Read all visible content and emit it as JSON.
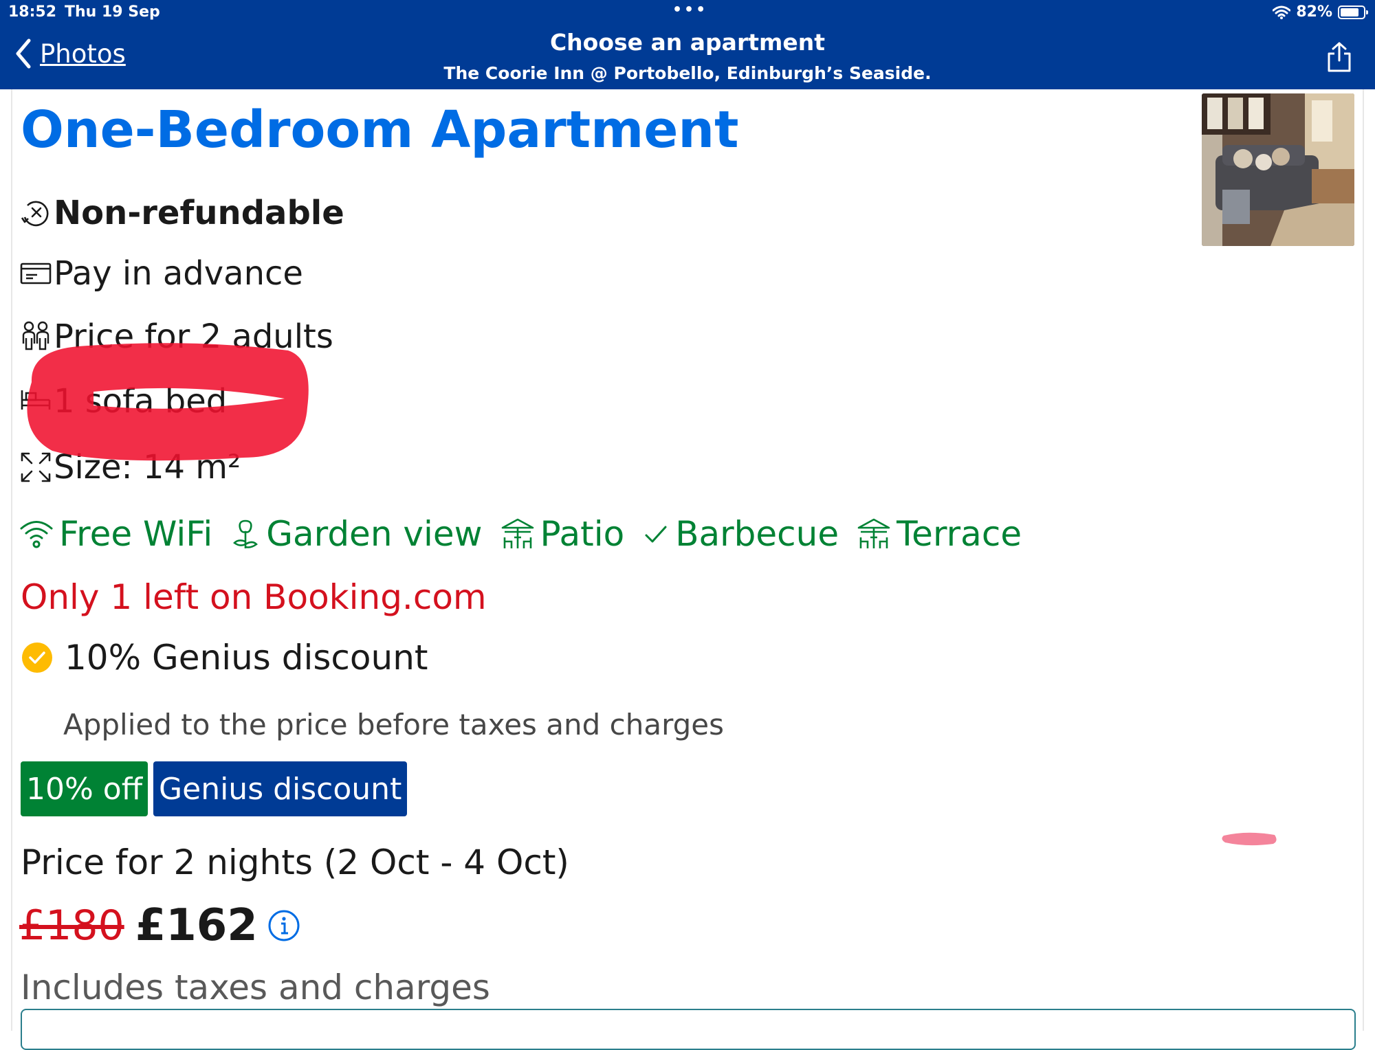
{
  "status_bar": {
    "time": "18:52",
    "date": "Thu 19 Sep",
    "battery": "82%",
    "battery_level": 0.82
  },
  "nav": {
    "back_label": "Photos",
    "title": "Choose an apartment",
    "subtitle": "The Coorie Inn @ Portobello, Edinburgh’s Seaside."
  },
  "room": {
    "title": "One-Bedroom Apartment",
    "policy": "Non-refundable",
    "payment": "Pay in advance",
    "occupancy": "Price for 2 adults",
    "beds": "1 sofa bed",
    "size": "Size: 14 m²"
  },
  "facilities": [
    {
      "icon": "wifi-icon",
      "label": "Free WiFi"
    },
    {
      "icon": "garden-icon",
      "label": "Garden view"
    },
    {
      "icon": "patio-icon",
      "label": "Patio"
    },
    {
      "icon": "check-icon",
      "label": "Barbecue"
    },
    {
      "icon": "terrace-icon",
      "label": "Terrace"
    }
  ],
  "availability": "Only 1 left on Booking.com",
  "genius": {
    "title": "10% Genius discount",
    "note": "Applied to the price before taxes and charges",
    "badge_off": "10% off",
    "badge_label": "Genius discount"
  },
  "pricing": {
    "label": "Price for 2 nights (2 Oct - 4 Oct)",
    "original": "£180",
    "current": "£162",
    "includes": "Includes taxes and charges"
  },
  "colors": {
    "brand_blue": "#003b95",
    "link_blue": "#006ce4",
    "facility_green": "#008234",
    "alert_red": "#d4111e",
    "genius_yellow": "#febb02"
  }
}
